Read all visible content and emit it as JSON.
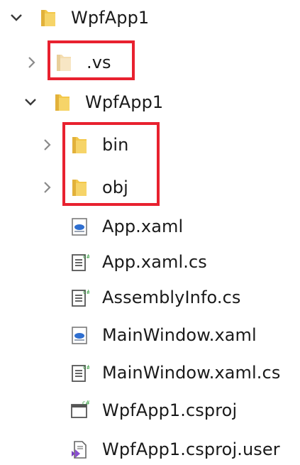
{
  "explorer": {
    "items": [
      {
        "label": "WpfApp1",
        "kind": "folder",
        "expander": "expanded"
      },
      {
        "label": ".vs",
        "kind": "folder",
        "expander": "collapsed"
      },
      {
        "label": "WpfApp1",
        "kind": "folder",
        "expander": "expanded"
      },
      {
        "label": "bin",
        "kind": "folder",
        "expander": "collapsed"
      },
      {
        "label": "obj",
        "kind": "folder",
        "expander": "collapsed"
      },
      {
        "label": "App.xaml",
        "kind": "xaml-file-icon"
      },
      {
        "label": "App.xaml.cs",
        "kind": "csharp-file-icon"
      },
      {
        "label": "AssemblyInfo.cs",
        "kind": "csharp-file-icon"
      },
      {
        "label": "MainWindow.xaml",
        "kind": "xaml-file-icon"
      },
      {
        "label": "MainWindow.xaml.cs",
        "kind": "csharp-file-icon"
      },
      {
        "label": "WpfApp1.csproj",
        "kind": "csproj-file-icon"
      },
      {
        "label": "WpfApp1.csproj.user",
        "kind": "vs-user-file-icon"
      }
    ]
  },
  "colors": {
    "highlight": "#e8212f",
    "folder": "#f3c84a",
    "chevron": "#8a8a8a"
  }
}
